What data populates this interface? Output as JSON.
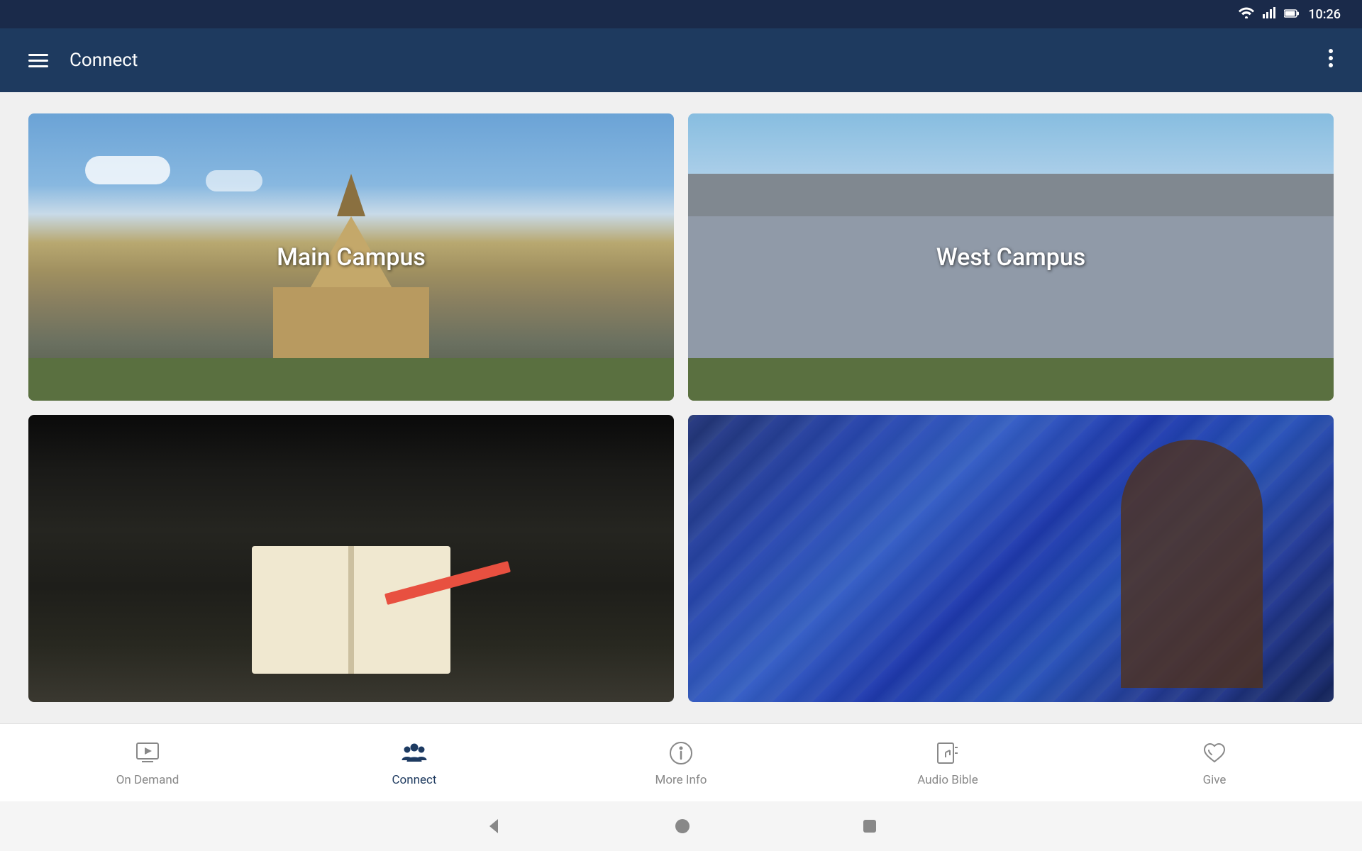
{
  "statusBar": {
    "time": "10:26",
    "wifiIcon": "wifi",
    "signalIcon": "signal",
    "batteryIcon": "battery"
  },
  "appBar": {
    "menuIcon": "menu",
    "title": "Connect",
    "moreIcon": "more-vert"
  },
  "cards": [
    {
      "id": "main-campus",
      "label": "Main Campus",
      "position": "top-left"
    },
    {
      "id": "west-campus",
      "label": "West Campus",
      "position": "top-right"
    },
    {
      "id": "study",
      "label": "",
      "position": "bottom-left"
    },
    {
      "id": "worship",
      "label": "",
      "position": "bottom-right"
    }
  ],
  "bottomNav": {
    "items": [
      {
        "id": "on-demand",
        "label": "On Demand",
        "icon": "play-circle",
        "active": false
      },
      {
        "id": "connect",
        "label": "Connect",
        "icon": "people",
        "active": true
      },
      {
        "id": "more-info",
        "label": "More Info",
        "icon": "info-circle",
        "active": false
      },
      {
        "id": "audio-bible",
        "label": "Audio Bible",
        "icon": "book-plus",
        "active": false
      },
      {
        "id": "give",
        "label": "Give",
        "icon": "favorite",
        "active": false
      }
    ]
  },
  "sysNav": {
    "backLabel": "back",
    "homeLabel": "home",
    "recentLabel": "recent"
  }
}
